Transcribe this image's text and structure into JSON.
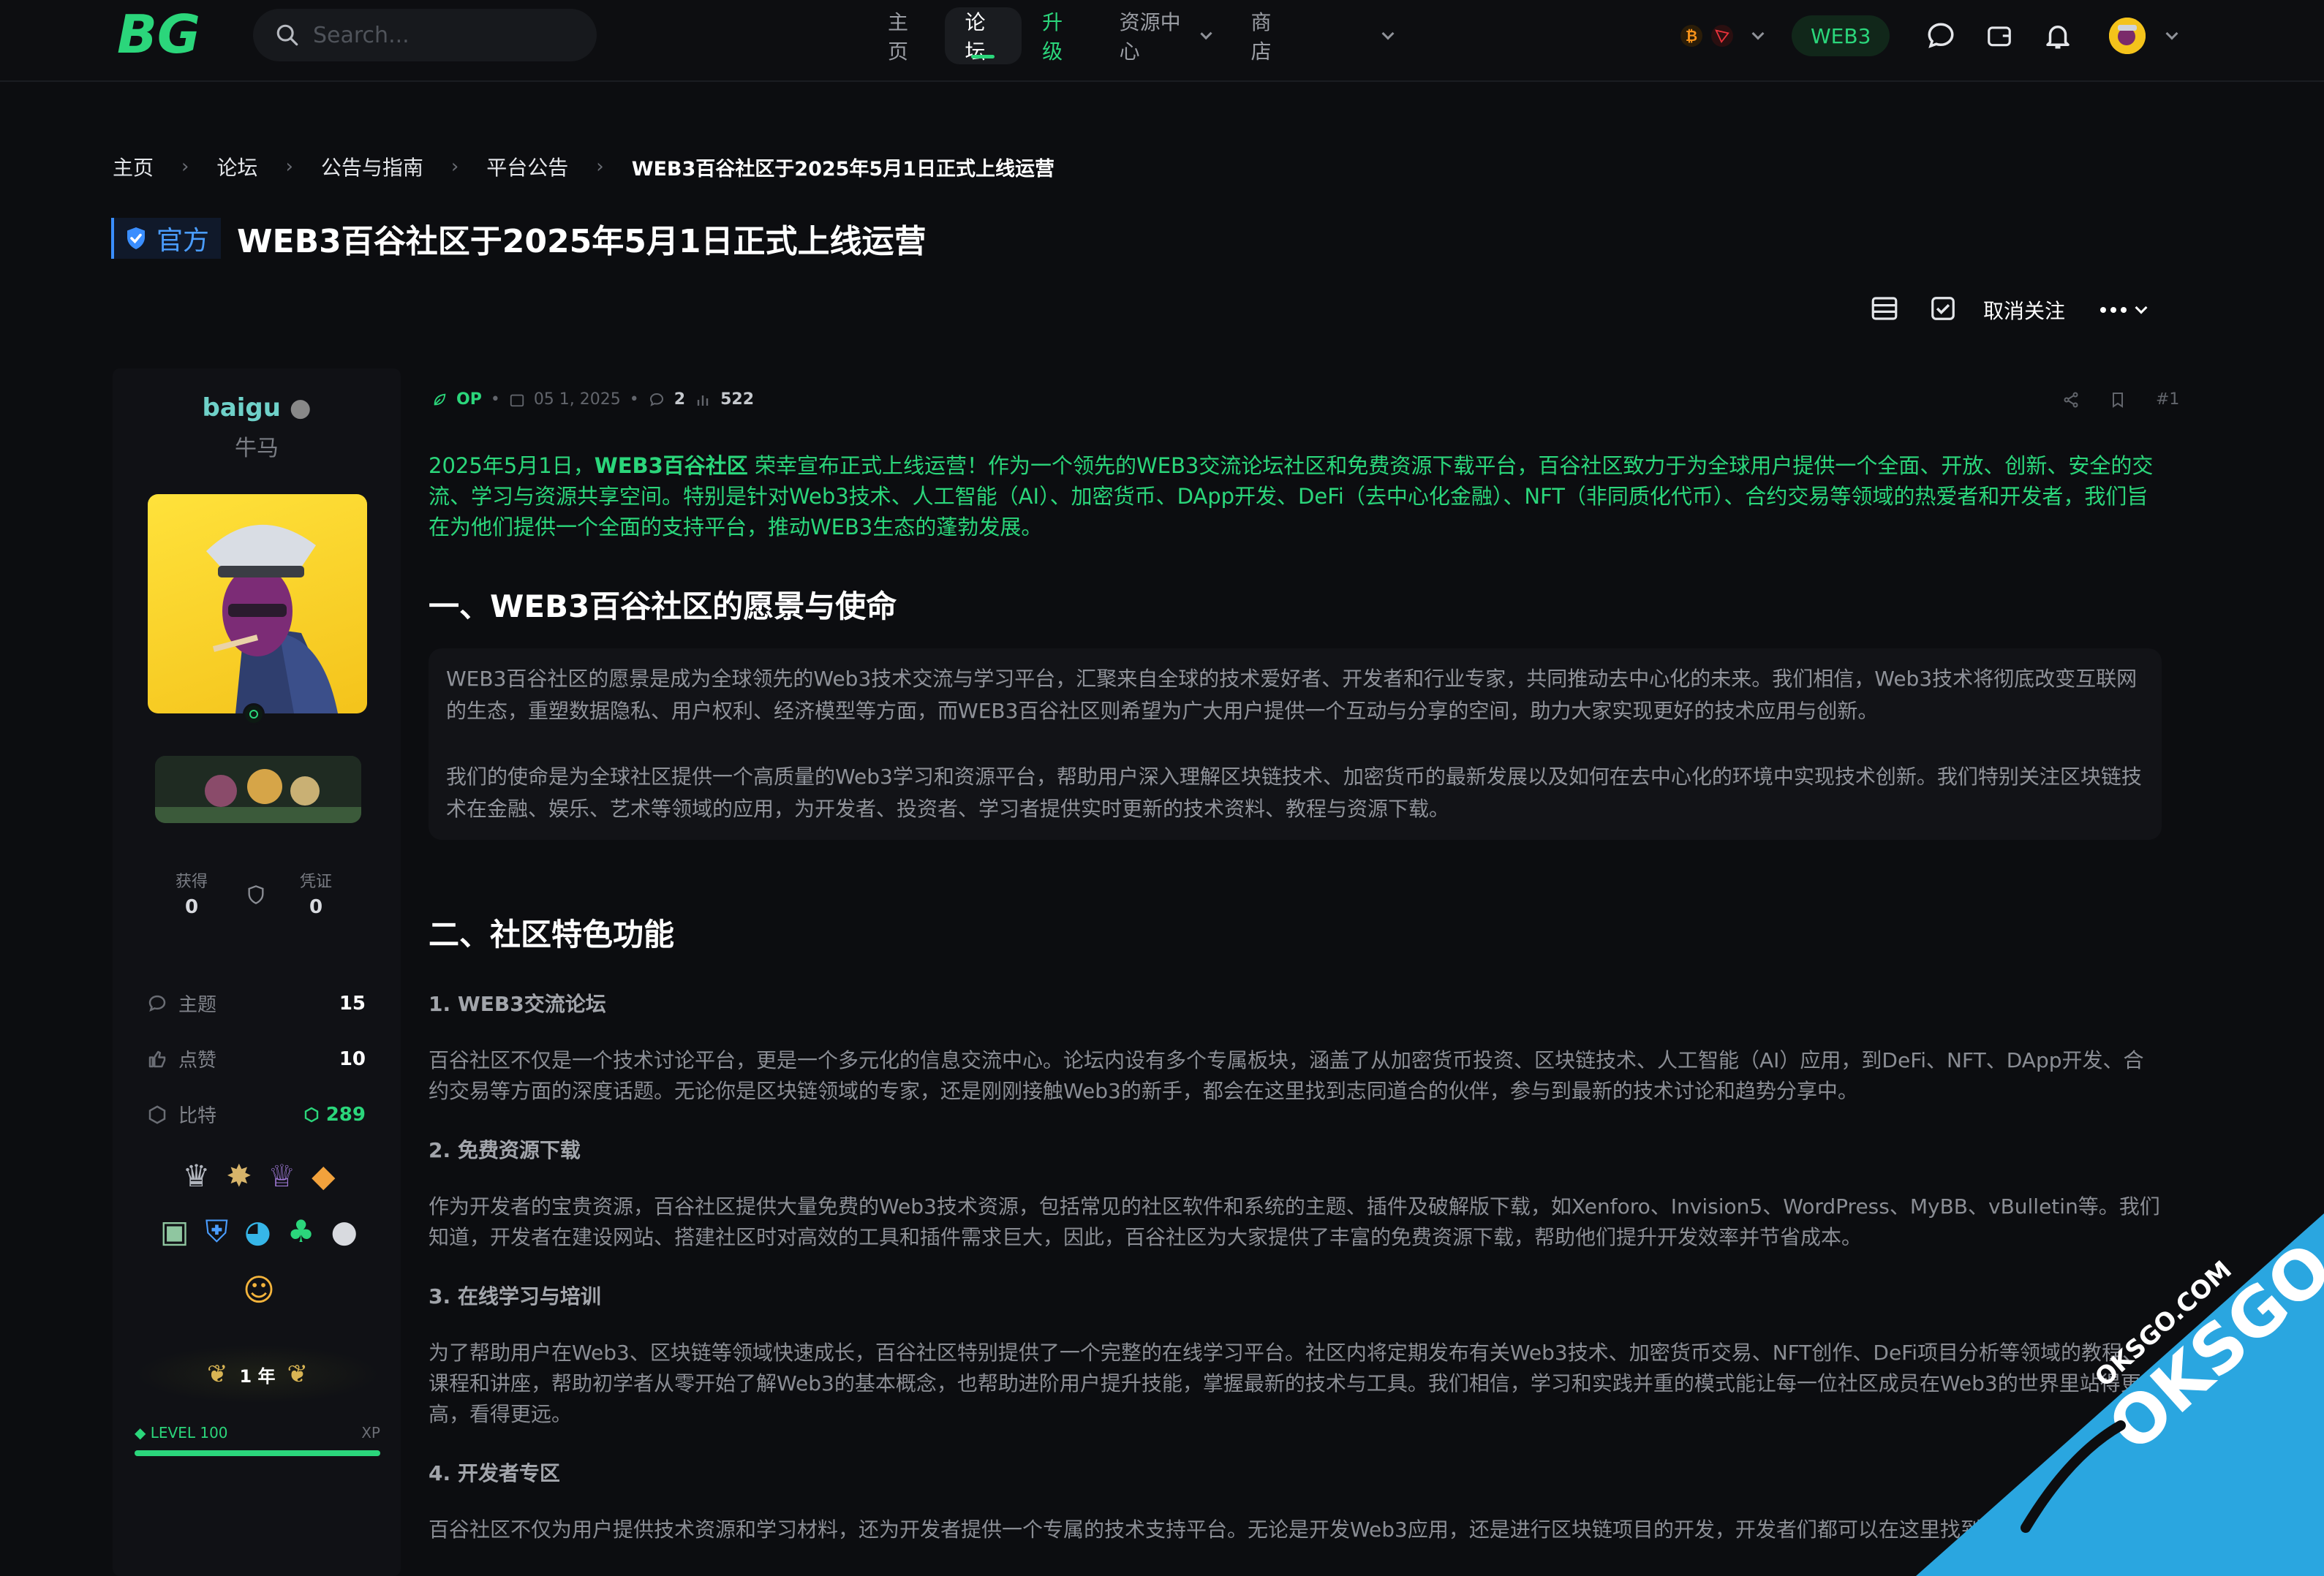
{
  "nav": {
    "logo_text": "BG",
    "search_placeholder": "Search...",
    "items": [
      {
        "label": "主页"
      },
      {
        "label": "论坛"
      },
      {
        "label": "升级"
      },
      {
        "label": "资源中心"
      },
      {
        "label": "商店"
      }
    ],
    "web3_label": "WEB3"
  },
  "breadcrumb": [
    "主页",
    "论坛",
    "公告与指南",
    "平台公告",
    "WEB3百谷社区于2025年5月1日正式上线运营"
  ],
  "thread": {
    "badge": "官方",
    "title": "WEB3百谷社区于2025年5月1日正式上线运营",
    "unfollow_label": "取消关注"
  },
  "user": {
    "name": "baigu",
    "title": "牛马",
    "earned_label": "获得",
    "earned_value": "0",
    "voucher_label": "凭证",
    "voucher_value": "0",
    "stats": [
      {
        "label": "主题",
        "value": "15"
      },
      {
        "label": "点赞",
        "value": "10"
      },
      {
        "label": "比特",
        "value": "289"
      }
    ],
    "year_label": "1 年",
    "level_label": "LEVEL 100",
    "xp_label": "XP",
    "level_progress": 1.0
  },
  "post": {
    "op_label": "OP",
    "date": "05 1, 2025",
    "replies": "2",
    "views": "522",
    "post_number": "#1",
    "intro_bold": "WEB3百谷社区",
    "intro_a": "2025年5月1日，",
    "intro_b": " 荣幸宣布正式上线运营！作为一个领先的WEB3交流论坛社区和免费资源下载平台，百谷社区致力于为全球用户提供一个全面、开放、创新、安全的交流、学习与资源共享空间。特别是针对Web3技术、人工智能（AI）、加密货币、DApp开发、DeFi（去中心化金融）、NFT（非同质化代币）、合约交易等领域的热爱者和开发者，我们旨在为他们提供一个全面的支持平台，推动WEB3生态的蓬勃发展。",
    "section1_title": "一、WEB3百谷社区的愿景与使命",
    "section1_p1": "WEB3百谷社区的愿景是成为全球领先的Web3技术交流与学习平台，汇聚来自全球的技术爱好者、开发者和行业专家，共同推动去中心化的未来。我们相信，Web3技术将彻底改变互联网的生态，重塑数据隐私、用户权利、经济模型等方面，而WEB3百谷社区则希望为广大用户提供一个互动与分享的空间，助力大家实现更好的技术应用与创新。",
    "section1_p2": "我们的使命是为全球社区提供一个高质量的Web3学习和资源平台，帮助用户深入理解区块链技术、加密货币的最新发展以及如何在去中心化的环境中实现技术创新。我们特别关注区块链技术在金融、娱乐、艺术等领域的应用，为开发者、投资者、学习者提供实时更新的技术资料、教程与资源下载。",
    "section2_title": "二、社区特色功能",
    "sub1": "1. WEB3交流论坛",
    "p1": "百谷社区不仅是一个技术讨论平台，更是一个多元化的信息交流中心。论坛内设有多个专属板块，涵盖了从加密货币投资、区块链技术、人工智能（AI）应用，到DeFi、NFT、DApp开发、合约交易等方面的深度话题。无论你是区块链领域的专家，还是刚刚接触Web3的新手，都会在这里找到志同道合的伙伴，参与到最新的技术讨论和趋势分享中。",
    "sub2": "2. 免费资源下载",
    "p2": "作为开发者的宝贵资源，百谷社区提供大量免费的Web3技术资源，包括常见的社区软件和系统的主题、插件及破解版下载，如Xenforo、Invision5、WordPress、MyBB、vBulletin等。我们知道，开发者在建设网站、搭建社区时对高效的工具和插件需求巨大，因此，百谷社区为大家提供了丰富的免费资源下载，帮助他们提升开发效率并节省成本。",
    "sub3": "3. 在线学习与培训",
    "p3": "为了帮助用户在Web3、区块链等领域快速成长，百谷社区特别提供了一个完整的在线学习平台。社区内将定期发布有关Web3技术、加密货币交易、NFT创作、DeFi项目分析等领域的教程、课程和讲座，帮助初学者从零开始了解Web3的基本概念，也帮助进阶用户提升技能，掌握最新的技术与工具。我们相信，学习和实践并重的模式能让每一位社区成员在Web3的世界里站得更高，看得更远。",
    "sub4": "4. 开发者专区",
    "p4": "百谷社区不仅为用户提供技术资源和学习材料，还为开发者提供一个专属的技术支持平台。无论是开发Web3应用，还是进行区块链项目的开发，开发者们都可以在这里找到所需的工具和"
  },
  "watermark": {
    "domain": "OKSGO.COM",
    "brand": "OKSGO"
  },
  "colors": {
    "accent": "#2bd67b",
    "official": "#4a9dff",
    "background": "#0c0d10"
  }
}
